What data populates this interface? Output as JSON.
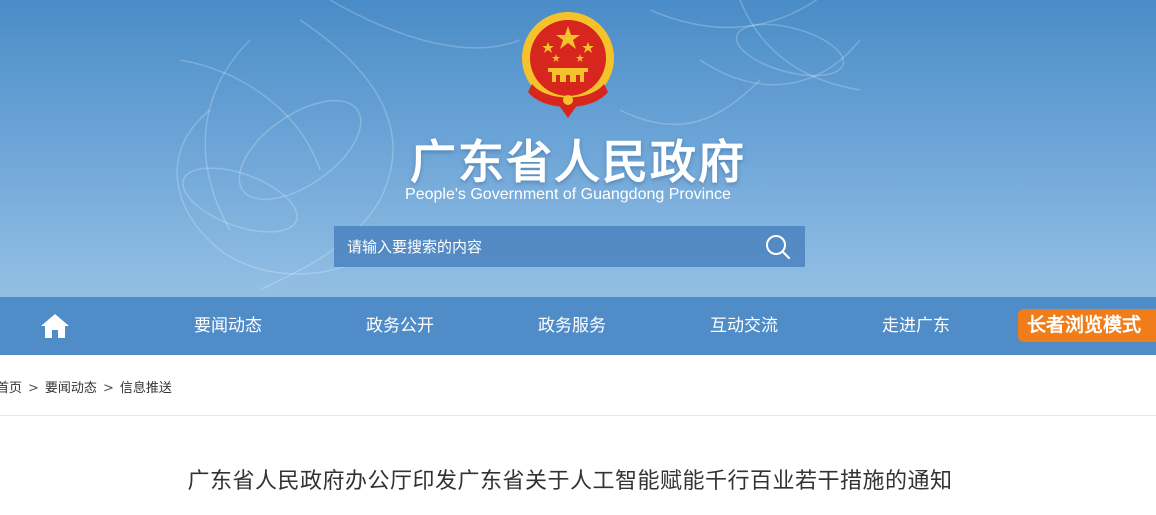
{
  "header": {
    "title": "广东省人民政府",
    "subtitle": "People's Government of Guangdong Province",
    "emblem_icon": "national-emblem-icon",
    "colors": {
      "banner_top": "#4a8cc7",
      "banner_bottom": "#94bfe4",
      "emblem_red": "#d7261e",
      "emblem_gold": "#f5c22b"
    }
  },
  "search": {
    "placeholder": "请输入要搜索的内容",
    "value": "",
    "icon": "search-icon"
  },
  "nav": {
    "home_icon": "home-icon",
    "items": [
      {
        "label": "要闻动态"
      },
      {
        "label": "政务公开"
      },
      {
        "label": "政务服务"
      },
      {
        "label": "互动交流"
      },
      {
        "label": "走进广东"
      }
    ],
    "elder_mode": "长者浏览模式",
    "colors": {
      "nav_bg": "#4f8cc8",
      "elder_bg": "#f07d1a"
    }
  },
  "breadcrumb": {
    "items": [
      "首页",
      "要闻动态",
      "信息推送"
    ],
    "separator": ">"
  },
  "article": {
    "title": "广东省人民政府办公厅印发广东省关于人工智能赋能千行百业若干措施的通知"
  }
}
